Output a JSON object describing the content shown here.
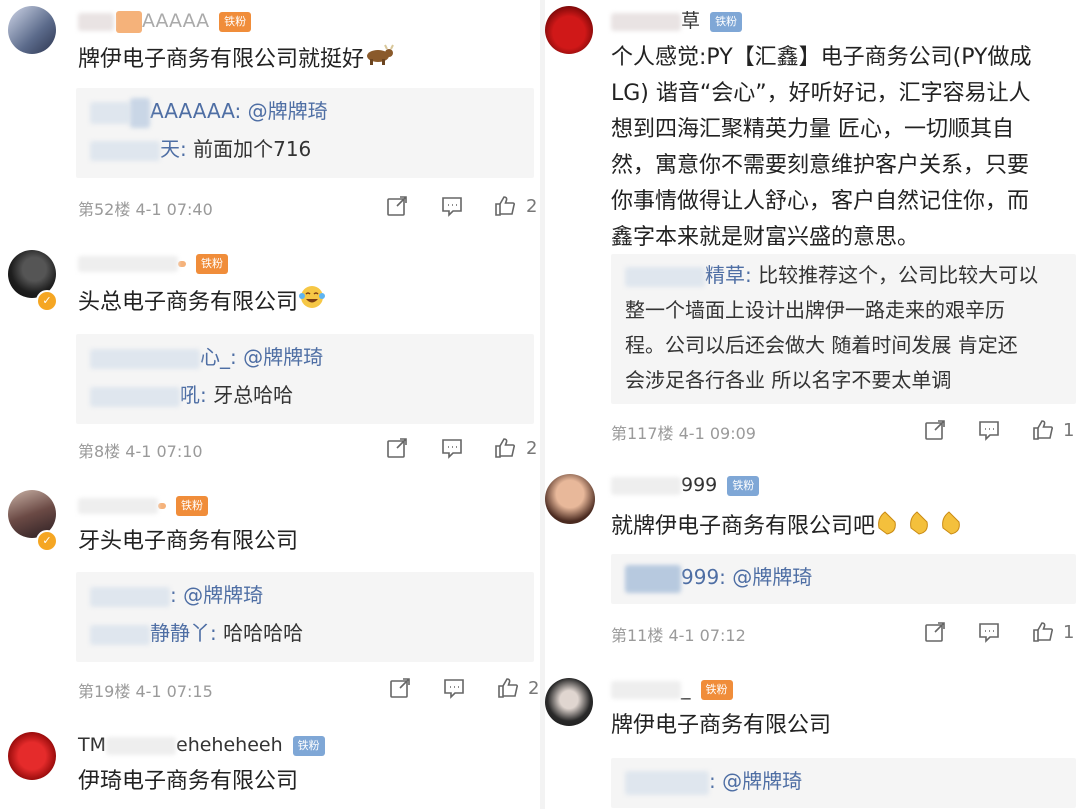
{
  "left_posts": [
    {
      "name_visible": "AAAAA",
      "badge": "铁粉",
      "text": "牌伊电子商务有限公司就挺好",
      "emoji": "ox",
      "reply1_who": "AAAAAA: @牌牌琦",
      "reply2_who": "天:",
      "reply2_text": " 前面加个716",
      "meta": "第52楼 4-1 07:40",
      "likes": "2"
    },
    {
      "name_visible": "",
      "badge": "铁粉",
      "text": "头总电子商务有限公司",
      "emoji": "laugh-cry",
      "reply1_who": "心_: @牌牌琦",
      "reply2_who": "吼:",
      "reply2_text": " 牙总哈哈",
      "meta": "第8楼 4-1 07:10",
      "likes": "2"
    },
    {
      "name_visible": "",
      "badge": "铁粉",
      "text": "牙头电子商务有限公司",
      "emoji": "",
      "reply1_who": ": @牌牌琦",
      "reply2_who": "静静丫:",
      "reply2_text": " 哈哈哈哈",
      "meta": "第19楼 4-1 07:15",
      "likes": "2"
    },
    {
      "name_visible": "TM",
      "name_tail": "eheheheeh",
      "badge": "铁粉",
      "text": "伊琦电子商务有限公司"
    }
  ],
  "right_posts": [
    {
      "name_visible": "草",
      "badge": "铁粉",
      "text_lines": [
        "个人感觉:PY【汇鑫】电子商务公司(PY做成",
        "LG) 谐音“会心”，好听好记，汇字容易让人",
        "想到四海汇聚精英力量 匠心，一切顺其自",
        "然，寓意你不需要刻意维护客户关系，只要",
        "你事情做得让人舒心，客户自然记住你，而",
        "鑫字本来就是财富兴盛的意思。"
      ],
      "reply_lines": [
        {
          "who": "精草:",
          "t": " 比较推荐这个，公司比较大可以"
        },
        {
          "who": "",
          "t": "整一个墙面上设计出牌伊一路走来的艰辛历"
        },
        {
          "who": "",
          "t": "程。公司以后还会做大 随着时间发展 肯定还"
        },
        {
          "who": "",
          "t": "会涉足各行各业 所以名字不要太单调"
        }
      ],
      "meta": "第117楼 4-1 09:09",
      "likes": "1"
    },
    {
      "name_visible": "999",
      "badge": "铁粉",
      "text": "就牌伊电子商务有限公司吧",
      "emoji": "clap",
      "reply1_who": "999: @牌牌琦",
      "meta": "第11楼 4-1 07:12",
      "likes": "1"
    },
    {
      "name_visible": "_",
      "badge": "铁粉",
      "text": "牌伊电子商务有限公司",
      "reply1_who": ": @牌牌琦"
    }
  ],
  "icons": {
    "share": "share-icon",
    "comment": "comment-icon",
    "like": "thumbs-up-icon"
  },
  "colors": {
    "link_blue": "#4e6ea4",
    "meta_gray": "#9a9a9a",
    "badge_orange": "#f08d3a"
  }
}
